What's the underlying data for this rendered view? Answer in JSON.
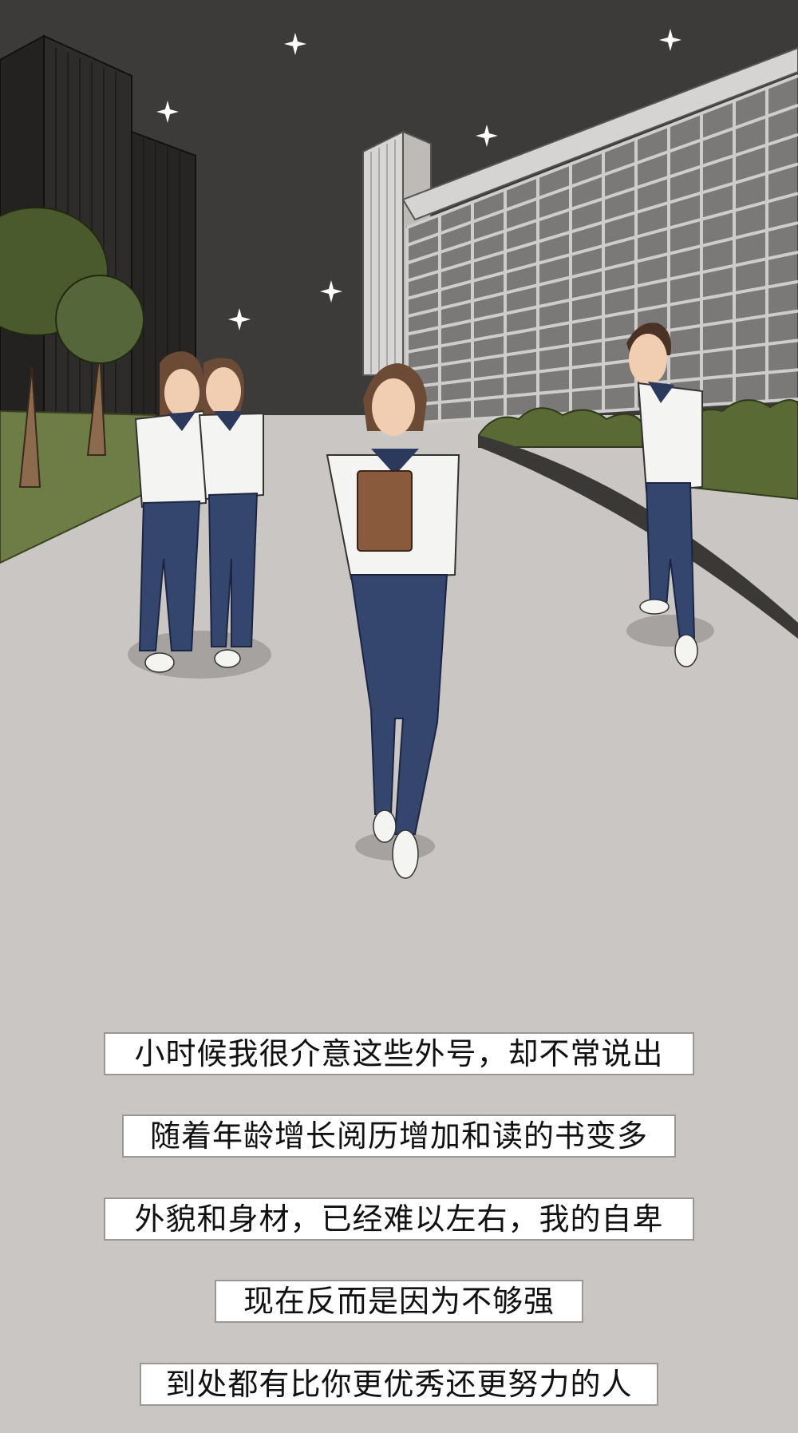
{
  "scene": {
    "colors": {
      "sky": "#3d3b3a",
      "ground": "#c9c6c4",
      "grass": "#6e7d45",
      "uniform_shirt": "#f4f4f2",
      "uniform_collar": "#2b3a5c",
      "uniform_pants": "#34456e",
      "book": "#8a5a3c",
      "hair": "#6b4a36"
    },
    "icons": [
      "sparkle-icon"
    ]
  },
  "captions": [
    "小时候我很介意这些外号，却不常说出",
    "随着年龄增长阅历增加和读的书变多",
    "外貌和身材，已经难以左右，我的自卑",
    "现在反而是因为不够强",
    "到处都有比你更优秀还更努力的人"
  ]
}
